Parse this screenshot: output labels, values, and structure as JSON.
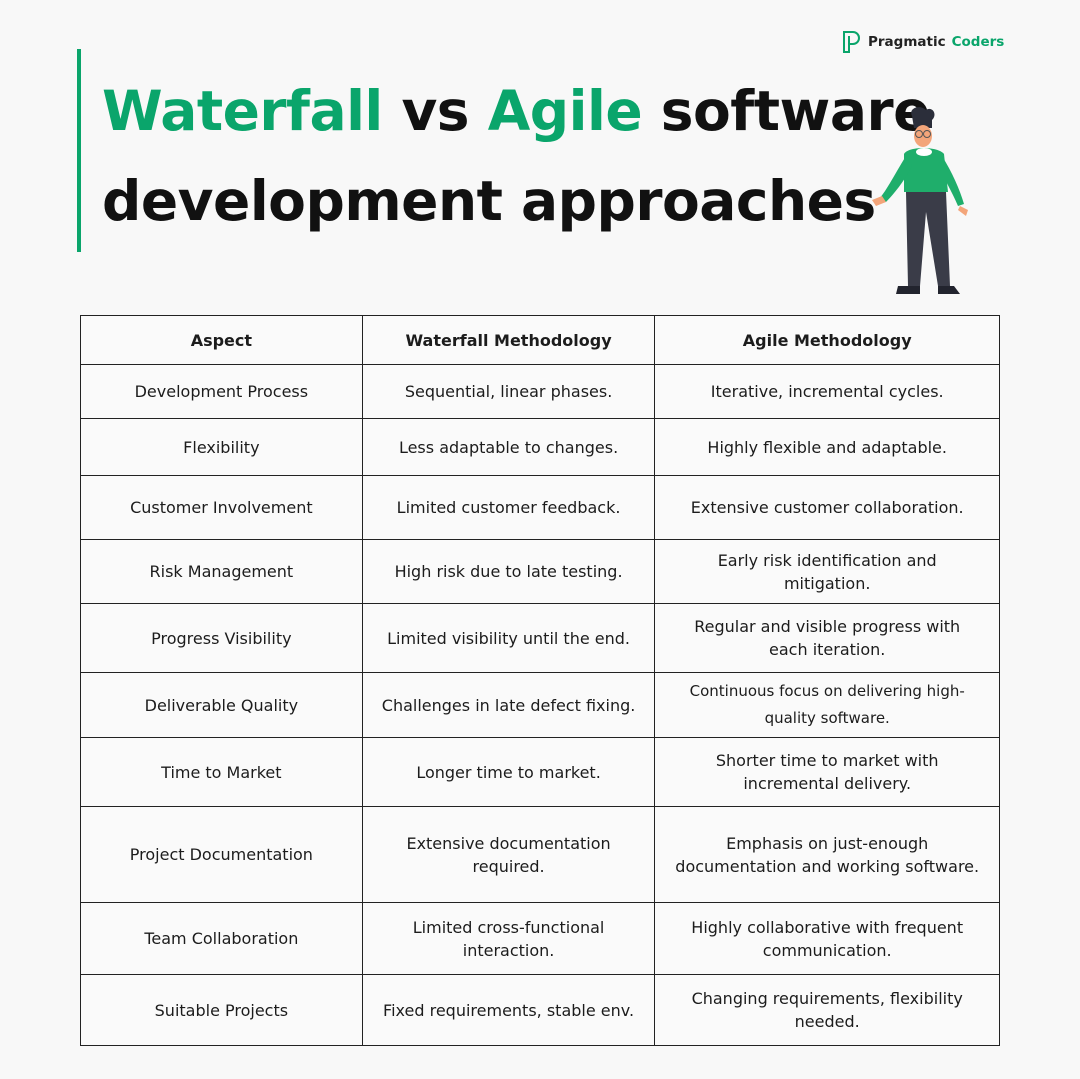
{
  "brand": {
    "name_part1": "Pragmatic",
    "name_part2": "Coders",
    "logo_icon": "pragmatic-coders-logo-icon",
    "accent_color": "#0aa56b"
  },
  "title": {
    "word1": "Waterfall",
    "word2": " vs ",
    "word3": "Agile",
    "word4": " software",
    "line2": "development approaches"
  },
  "illustration": "person-standing-shrugging-illustration",
  "table": {
    "headers": [
      "Aspect",
      "Waterfall Methodology",
      "Agile Methodology"
    ],
    "rows": [
      [
        "Development Process",
        "Sequential, linear phases.",
        "Iterative, incremental cycles."
      ],
      [
        "Flexibility",
        "Less adaptable to changes.",
        "Highly flexible and adaptable."
      ],
      [
        "Customer Involvement",
        "Limited customer feedback.",
        "Extensive customer collaboration."
      ],
      [
        "Risk Management",
        "High risk due to late testing.",
        "Early risk identification and mitigation."
      ],
      [
        "Progress Visibility",
        "Limited visibility until the end.",
        "Regular and visible progress with each iteration."
      ],
      [
        "Deliverable Quality",
        "Challenges in late defect fixing.",
        "Continuous focus on delivering high-quality software."
      ],
      [
        "Time to Market",
        "Longer time to market.",
        "Shorter time to market with incremental delivery."
      ],
      [
        "Project Documentation",
        "Extensive documentation required.",
        "Emphasis on just-enough documentation and working software."
      ],
      [
        "Team Collaboration",
        "Limited cross-functional interaction.",
        "Highly collaborative with frequent communication."
      ],
      [
        "Suitable Projects",
        "Fixed requirements, stable env.",
        "Changing requirements, flexibility needed."
      ]
    ]
  }
}
